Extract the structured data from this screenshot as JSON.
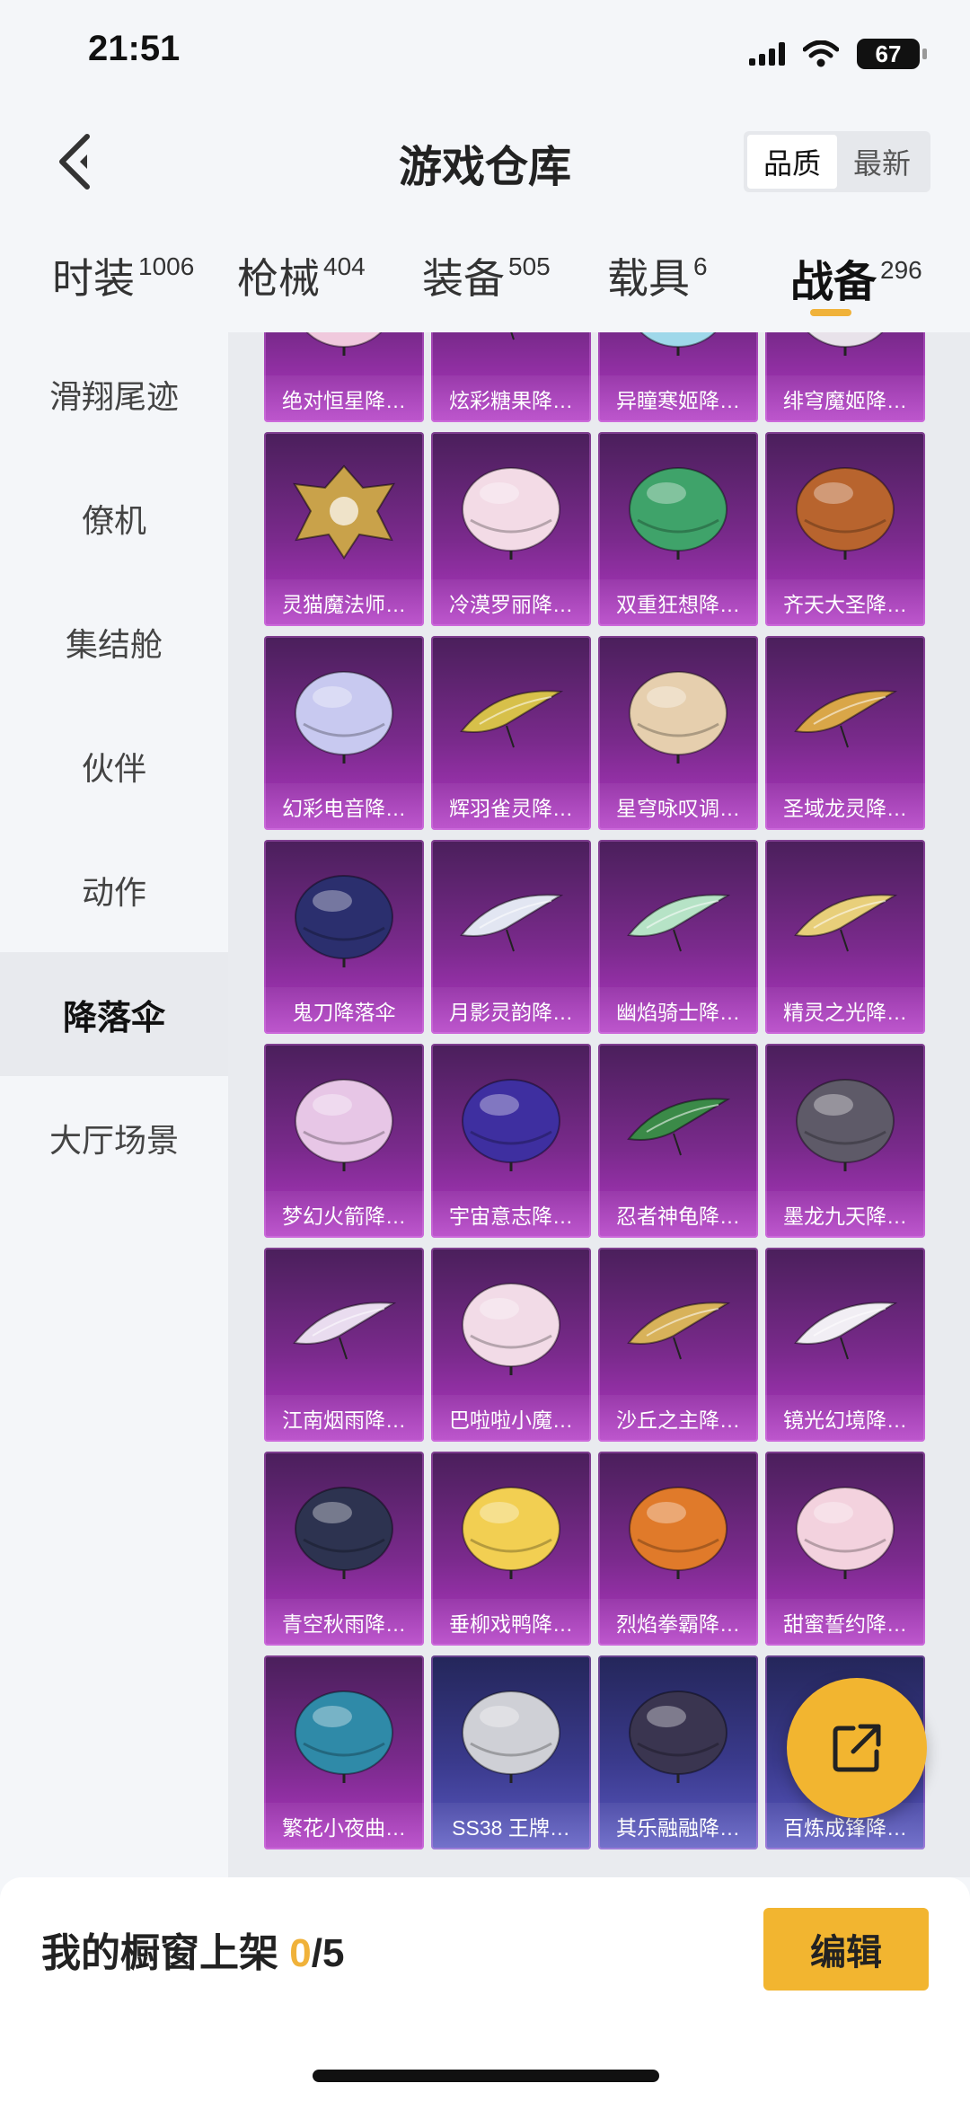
{
  "status": {
    "time": "21:51",
    "battery": "67"
  },
  "header": {
    "title": "游戏仓库",
    "sort_options": [
      "品质",
      "最新"
    ],
    "active_sort": "品质"
  },
  "tabs": [
    {
      "label": "时装",
      "count": "1006"
    },
    {
      "label": "枪械",
      "count": "404"
    },
    {
      "label": "装备",
      "count": "505"
    },
    {
      "label": "载具",
      "count": "6"
    },
    {
      "label": "战备",
      "count": "296"
    }
  ],
  "active_tab": "战备",
  "sidebar": {
    "items": [
      "滑翔尾迹",
      "僚机",
      "集结舱",
      "伙伴",
      "动作",
      "降落伞",
      "大厅场景"
    ],
    "active": "降落伞"
  },
  "items": [
    {
      "name": "绝对恒星降…",
      "icon": "parachute-icon",
      "color": "#f0c9dd"
    },
    {
      "name": "炫彩糖果降…",
      "icon": "glider-icon",
      "color": "#c9d8f5"
    },
    {
      "name": "异瞳寒姬降…",
      "icon": "parachute-icon",
      "color": "#9fd8ea"
    },
    {
      "name": "绯穹魔姬降…",
      "icon": "parachute-icon",
      "color": "#e8e2ea"
    },
    {
      "name": "灵猫魔法师…",
      "icon": "emblem-icon",
      "color": "#c9a24a"
    },
    {
      "name": "冷漠罗丽降…",
      "icon": "parachute-icon",
      "color": "#f3dbe6"
    },
    {
      "name": "双重狂想降…",
      "icon": "parachute-icon",
      "color": "#3fa36a"
    },
    {
      "name": "齐天大圣降…",
      "icon": "parachute-icon",
      "color": "#b8642e"
    },
    {
      "name": "幻彩电音降…",
      "icon": "parachute-icon",
      "color": "#c8c9f0"
    },
    {
      "name": "辉羽雀灵降…",
      "icon": "glider-icon",
      "color": "#d7c04a"
    },
    {
      "name": "星穹咏叹调…",
      "icon": "parachute-icon",
      "color": "#e6cfae"
    },
    {
      "name": "圣域龙灵降…",
      "icon": "glider-icon",
      "color": "#d9a648"
    },
    {
      "name": "鬼刀降落伞",
      "icon": "parachute-icon",
      "color": "#2b2f6e"
    },
    {
      "name": "月影灵韵降…",
      "icon": "glider-icon",
      "color": "#e2e6f2"
    },
    {
      "name": "幽焰骑士降…",
      "icon": "glider-icon",
      "color": "#b6e3c6"
    },
    {
      "name": "精灵之光降…",
      "icon": "glider-icon",
      "color": "#e8cf7a"
    },
    {
      "name": "梦幻火箭降…",
      "icon": "parachute-icon",
      "color": "#e7c6e6"
    },
    {
      "name": "宇宙意志降…",
      "icon": "parachute-icon",
      "color": "#3e2fa0"
    },
    {
      "name": "忍者神龟降…",
      "icon": "glider-icon",
      "color": "#3b8a48"
    },
    {
      "name": "墨龙九天降…",
      "icon": "parachute-icon",
      "color": "#5e5a68"
    },
    {
      "name": "江南烟雨降…",
      "icon": "glider-icon",
      "color": "#e9dcef"
    },
    {
      "name": "巴啦啦小魔…",
      "icon": "parachute-icon",
      "color": "#f2dbe7"
    },
    {
      "name": "沙丘之主降…",
      "icon": "glider-icon",
      "color": "#d8b25a"
    },
    {
      "name": "镜光幻境降…",
      "icon": "glider-icon",
      "color": "#f1eef4"
    },
    {
      "name": "青空秋雨降…",
      "icon": "parachute-icon",
      "color": "#2d3350"
    },
    {
      "name": "垂柳戏鸭降…",
      "icon": "parachute-icon",
      "color": "#f2cf52"
    },
    {
      "name": "烈焰拳霸降…",
      "icon": "parachute-icon",
      "color": "#e07a2a"
    },
    {
      "name": "甜蜜誓约降…",
      "icon": "parachute-icon",
      "color": "#f3d2de"
    },
    {
      "name": "繁花小夜曲…",
      "icon": "parachute-icon",
      "color": "#2f8aa8"
    },
    {
      "name": "SS38 王牌…",
      "icon": "parachute-icon",
      "color": "#cfd0d6",
      "rarity": "blue"
    },
    {
      "name": "其乐融融降…",
      "icon": "parachute-icon",
      "color": "#3a3550",
      "rarity": "blue"
    },
    {
      "name": "百炼成锋降…",
      "icon": "parachute-icon",
      "color": "#c8c8d0",
      "rarity": "blue"
    }
  ],
  "bottom": {
    "label": "我的橱窗上架",
    "used": "0",
    "total": "/5",
    "edit_label": "编辑"
  },
  "theme": {
    "accent": "#f2b530",
    "card_purple": "#8a2d9c",
    "card_blue": "#3a3a8c"
  }
}
